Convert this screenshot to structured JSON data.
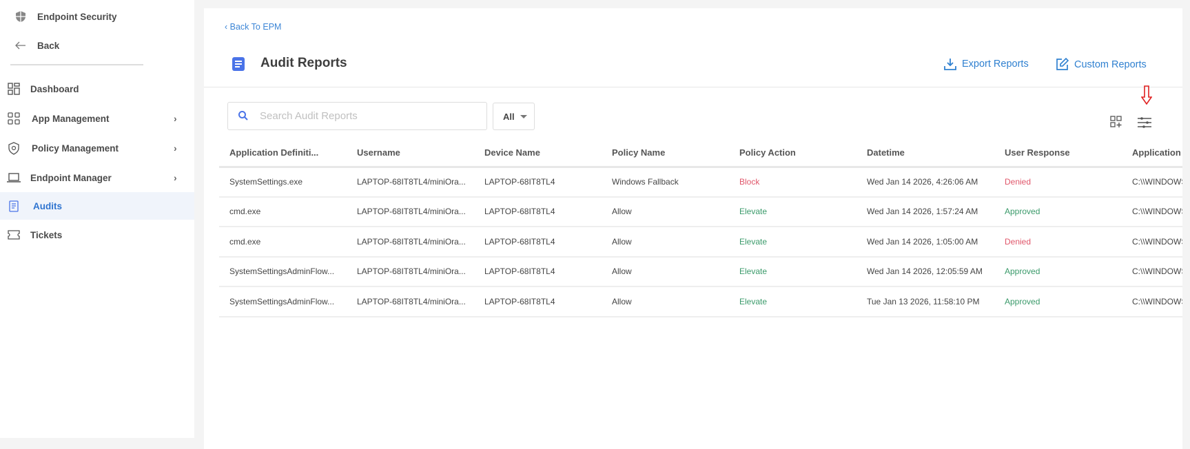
{
  "sidebar": {
    "app_title": "Endpoint Security",
    "back": "Back",
    "items": [
      {
        "label": "Dashboard",
        "icon": "dashboard-icon",
        "has_children": false
      },
      {
        "label": "App Management",
        "icon": "apps-icon",
        "has_children": true
      },
      {
        "label": "Policy Management",
        "icon": "shield-search-icon",
        "has_children": true
      },
      {
        "label": "Endpoint Manager",
        "icon": "laptop-icon",
        "has_children": true
      },
      {
        "label": "Audits",
        "icon": "document-icon",
        "active": true
      },
      {
        "label": "Tickets",
        "icon": "ticket-icon"
      }
    ]
  },
  "header": {
    "back_link": "Back To EPM",
    "title": "Audit Reports",
    "export": "Export Reports",
    "custom": "Custom Reports"
  },
  "toolbar": {
    "search_placeholder": "Search Audit Reports",
    "search_value": "",
    "filter": "All"
  },
  "colors": {
    "accent": "#2f80d0",
    "denied": "#e0566a",
    "approved": "#3a9a6a",
    "arrow": "#e02020"
  },
  "table": {
    "columns": [
      "Application Definiti...",
      "Username",
      "Device Name",
      "Policy Name",
      "Policy Action",
      "Datetime",
      "User Response",
      "Application"
    ],
    "rows": [
      [
        "SystemSettings.exe",
        "LAPTOP-68IT8TL4/miniOra...",
        "LAPTOP-68IT8TL4",
        "Windows Fallback",
        "Block",
        "Wed Jan 14 2026, 4:26:06 AM",
        "Denied",
        "C:\\\\WINDOWS"
      ],
      [
        "cmd.exe",
        "LAPTOP-68IT8TL4/miniOra...",
        "LAPTOP-68IT8TL4",
        "Allow",
        "Elevate",
        "Wed Jan 14 2026, 1:57:24 AM",
        "Approved",
        "C:\\\\WINDOWS"
      ],
      [
        "cmd.exe",
        "LAPTOP-68IT8TL4/miniOra...",
        "LAPTOP-68IT8TL4",
        "Allow",
        "Elevate",
        "Wed Jan 14 2026, 1:05:00 AM",
        "Denied",
        "C:\\\\WINDOWS"
      ],
      [
        "SystemSettingsAdminFlow...",
        "LAPTOP-68IT8TL4/miniOra...",
        "LAPTOP-68IT8TL4",
        "Allow",
        "Elevate",
        "Wed Jan 14 2026, 12:05:59 AM",
        "Approved",
        "C:\\\\WINDOWS"
      ],
      [
        "SystemSettingsAdminFlow...",
        "LAPTOP-68IT8TL4/miniOra...",
        "LAPTOP-68IT8TL4",
        "Allow",
        "Elevate",
        "Tue Jan 13 2026, 11:58:10 PM",
        "Approved",
        "C:\\\\WINDOWS"
      ]
    ]
  }
}
